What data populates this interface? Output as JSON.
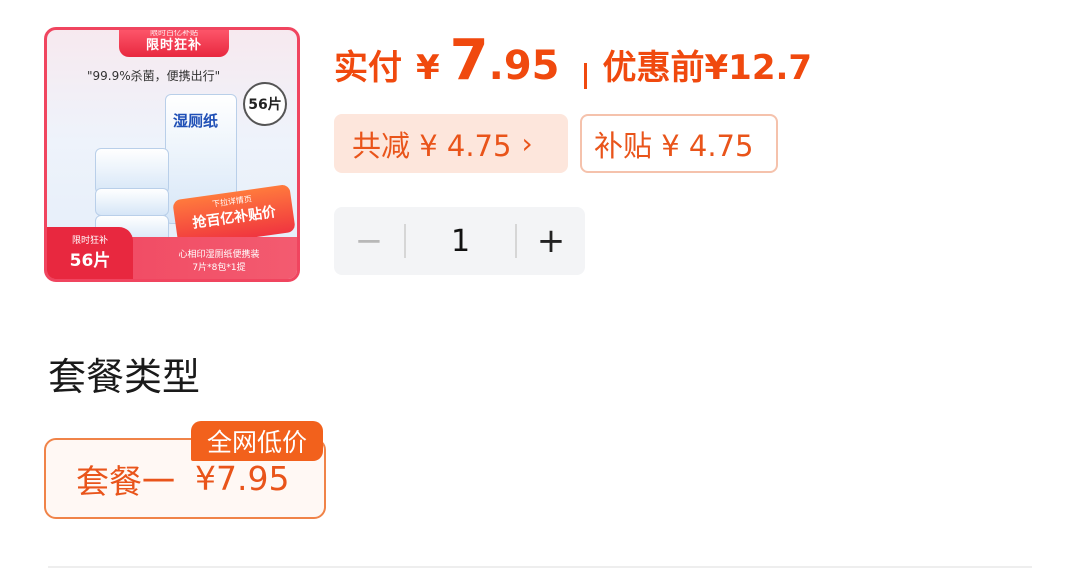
{
  "product_image": {
    "ribbon_top": "限时百亿补贴",
    "ribbon_main": "限时狂补",
    "slogan": "\"99.9%杀菌，便携出行\"",
    "pack_count": "56片",
    "brand": "心相印",
    "product_name": "湿厕纸",
    "promo_small": "下拉详情页",
    "promo_big": "抢百亿补贴价",
    "corner_small": "限时狂补",
    "corner_big": "56片",
    "bottom_line1": "心相印湿厕纸便携装",
    "bottom_line2": "7片*8包*1提",
    "colors": {
      "frame": "#f0455f",
      "promo": "#f0353f"
    }
  },
  "price": {
    "pay_label": "实付",
    "currency": "¥",
    "pay_int": "7",
    "pay_dec": ".95",
    "before_label": "优惠前",
    "before_value": "¥12.7",
    "accent_color": "#f0490e"
  },
  "tags": {
    "reduce_label": "共减 ¥ 4.75",
    "reduce_chevron": "›",
    "subsidy_label": "补贴 ¥ 4.75"
  },
  "quantity": {
    "minus": "−",
    "value": "1",
    "plus": "+"
  },
  "package": {
    "section_title": "套餐类型",
    "options": [
      {
        "label": "套餐一",
        "price": "¥7.95",
        "badge": "全网低价",
        "selected": true
      }
    ]
  }
}
